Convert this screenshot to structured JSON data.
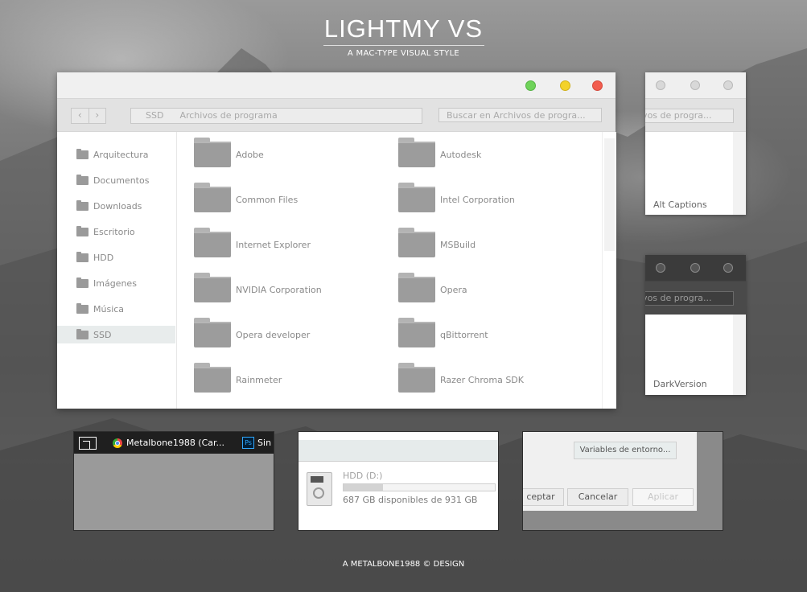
{
  "header": {
    "title": "LIGHTMY VS",
    "subtitle": "A MAC-TYPE VISUAL STYLE"
  },
  "footer": {
    "credit": "A METALBONE1988 © DESIGN"
  },
  "window": {
    "traffic_lights": {
      "green": "#6fd35a",
      "yellow": "#f3d22a",
      "red": "#f25d4f"
    },
    "nav": {
      "back": "‹",
      "forward": "›"
    },
    "address": {
      "root": "SSD",
      "folder": "Archivos de programa"
    },
    "search_placeholder": "Buscar en Archivos de progra...",
    "sidebar": [
      {
        "label": "Arquitectura"
      },
      {
        "label": "Documentos"
      },
      {
        "label": "Downloads"
      },
      {
        "label": "Escritorio"
      },
      {
        "label": "HDD"
      },
      {
        "label": "Imágenes"
      },
      {
        "label": "Música"
      },
      {
        "label": "SSD",
        "selected": true
      }
    ],
    "folders": [
      "Adobe",
      "Autodesk",
      "Common Files",
      "Intel Corporation",
      "Internet Explorer",
      "MSBuild",
      "NVIDIA Corporation",
      "Opera",
      "Opera developer",
      "qBittorrent",
      "Rainmeter",
      "Razer Chroma SDK"
    ]
  },
  "previews": {
    "alt": {
      "search": "ivos de progra...",
      "caption": "Alt Captions"
    },
    "dark": {
      "search": "ivos de progra...",
      "caption": "DarkVersion"
    },
    "taskbar": {
      "chrome_title": "Metalbone1988 (Car...",
      "ps_label": "Ps",
      "ps_title": "Sin"
    },
    "drive": {
      "name": "HDD (D:)",
      "free_text": "687 GB disponibles de 931 GB",
      "used_fraction": 0.26
    },
    "dialog": {
      "env_button": "Variables de entorno...",
      "ok": "ceptar",
      "cancel": "Cancelar",
      "apply": "Aplicar"
    }
  }
}
